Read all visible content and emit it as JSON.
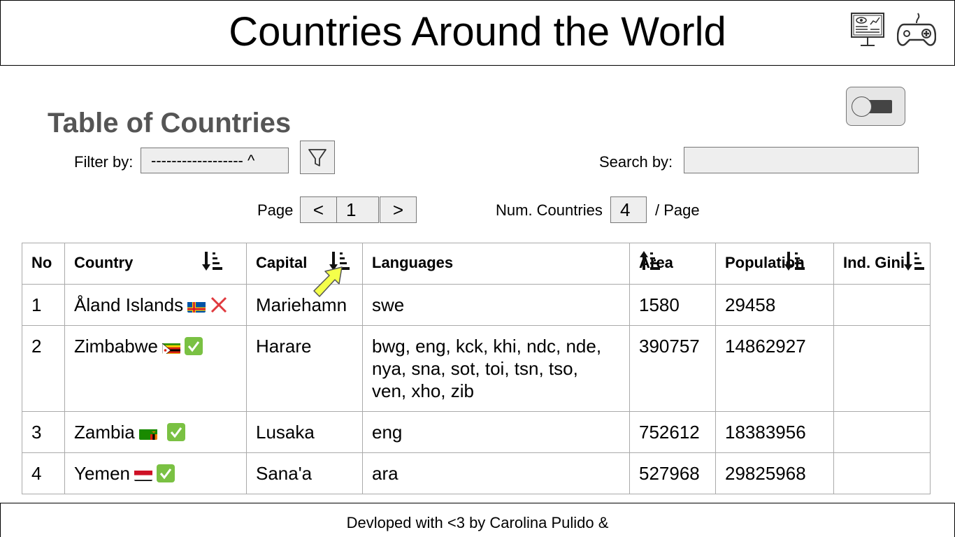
{
  "header": {
    "title": "Countries Around the World",
    "icons": [
      "dashboard-monitor-icon",
      "gamepad-icon"
    ]
  },
  "section_title": "Table of Countries",
  "filter": {
    "label": "Filter by:",
    "selected": "------------------ ^",
    "button_icon": "funnel-icon"
  },
  "search": {
    "label": "Search by:",
    "value": ""
  },
  "pagination": {
    "page_label": "Page",
    "prev": "<",
    "current": "1",
    "next": ">",
    "num_label": "Num. Countries",
    "num_value": "4",
    "per_page_label": "/ Page"
  },
  "table": {
    "headers": [
      "No",
      "Country",
      "Capital",
      "Languages",
      "Area",
      "Population",
      "Ind. Gini"
    ],
    "rows": [
      {
        "no": "1",
        "country": "Åland Islands",
        "flag": "aland",
        "status": "cross",
        "capital": "Mariehamn",
        "languages": "swe",
        "area": "1580",
        "population": "29458",
        "gini": ""
      },
      {
        "no": "2",
        "country": "Zimbabwe",
        "flag": "zimbabwe",
        "status": "check",
        "capital": "Harare",
        "languages": "bwg, eng, kck, khi, ndc, nde, nya, sna, sot, toi, tsn, tso, ven, xho, zib",
        "area": "390757",
        "population": "14862927",
        "gini": ""
      },
      {
        "no": "3",
        "country": "Zambia",
        "flag": "zambia",
        "status": "check",
        "capital": "Lusaka",
        "languages": "eng",
        "area": "752612",
        "population": "18383956",
        "gini": ""
      },
      {
        "no": "4",
        "country": "Yemen",
        "flag": "yemen",
        "status": "check",
        "capital": "Sana'a",
        "languages": "ara",
        "area": "527968",
        "population": "29825968",
        "gini": ""
      }
    ]
  },
  "footer": {
    "text": "Devloped with <3 by Carolina Pulido &"
  },
  "colors": {
    "input_bg": "#eeeeee",
    "border": "#aaaaaa",
    "title_gray": "#555555",
    "cursor_yellow": "#f4ff4a",
    "check_green": "#7ac143",
    "cross_red": "#e0393e"
  }
}
